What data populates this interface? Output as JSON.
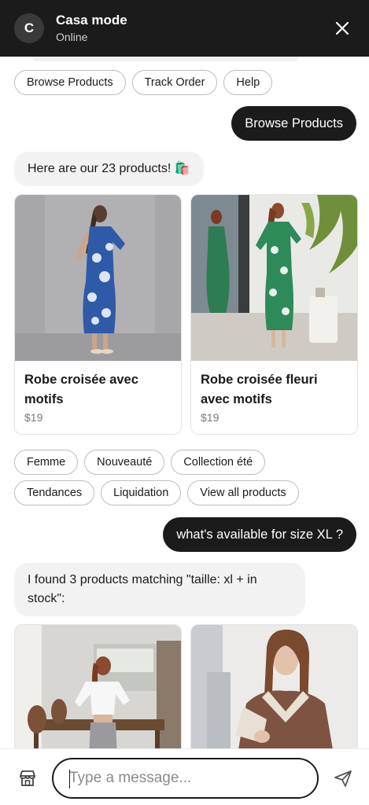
{
  "header": {
    "avatar_letter": "C",
    "title": "Casa mode",
    "status": "Online",
    "close_icon": "close-icon"
  },
  "quick_replies_top": [
    "Browse Products",
    "Track Order",
    "Help"
  ],
  "messages": {
    "user_1": "Browse Products",
    "bot_1": "Here are our 23 products! 🛍️",
    "products_1": [
      {
        "title": "Robe croisée avec motifs",
        "price": "$19",
        "image": "woman in blue floral wrap dress"
      },
      {
        "title": "Robe croisée fleuri avec motifs",
        "price": "$19",
        "image": "woman in green floral wrap dress"
      }
    ],
    "category_chips_row1": [
      "Femme",
      "Nouveauté",
      "Collection été"
    ],
    "category_chips_row2": [
      "Tendances",
      "Liquidation",
      "View all products"
    ],
    "user_2": "what's available for size XL ?",
    "bot_2": "I found 3 products matching \"taille: xl + in stock\":",
    "products_2": [
      {
        "image": "woman in white crop shirt and grey pants"
      },
      {
        "image": "woman in brown shearling jacket"
      }
    ]
  },
  "composer": {
    "placeholder": "Type a message...",
    "store_icon": "store-icon",
    "send_icon": "send-icon"
  },
  "colors": {
    "header_bg": "#1b1b1b",
    "user_bubble": "#1b1b1b",
    "bot_bubble": "#f2f2f2",
    "chip_border": "#bdbdbd"
  }
}
